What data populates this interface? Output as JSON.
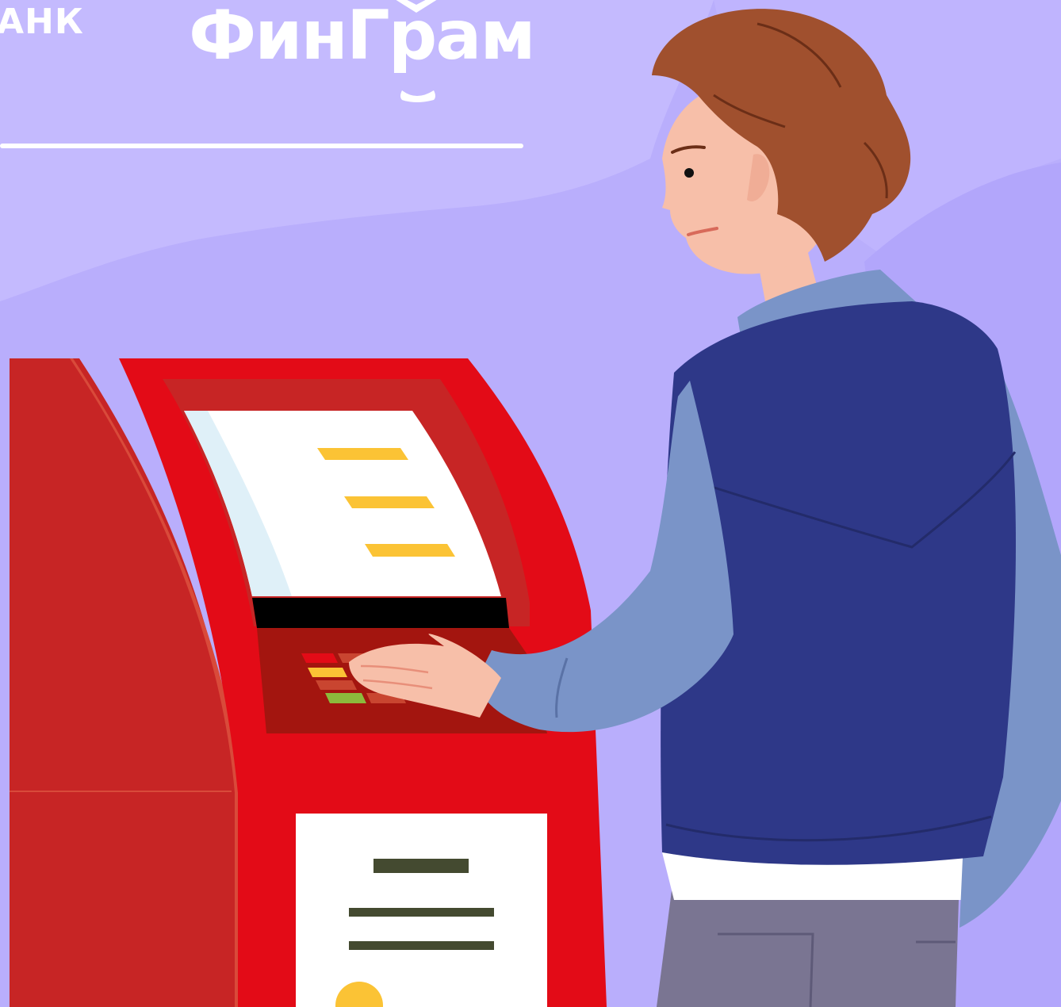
{
  "header": {
    "bank_text": "АНК",
    "logo_text": "ФинГрам"
  },
  "colors": {
    "background": "#b9aefc",
    "atm_red": "#e30b17",
    "atm_dark_red": "#c72525",
    "keypad_panel": "#a3150f",
    "screen_bars": "#fbc335",
    "receipt_bars": "#444a30",
    "jacket": "#2e3888",
    "shirt": "#7a94c8",
    "hair": "#a0502e",
    "skin": "#f7bfa9",
    "pants": "#7a7592"
  },
  "icons": {
    "logo_roof": "chevron-up-icon",
    "logo_smile": "smile-underline-icon"
  }
}
